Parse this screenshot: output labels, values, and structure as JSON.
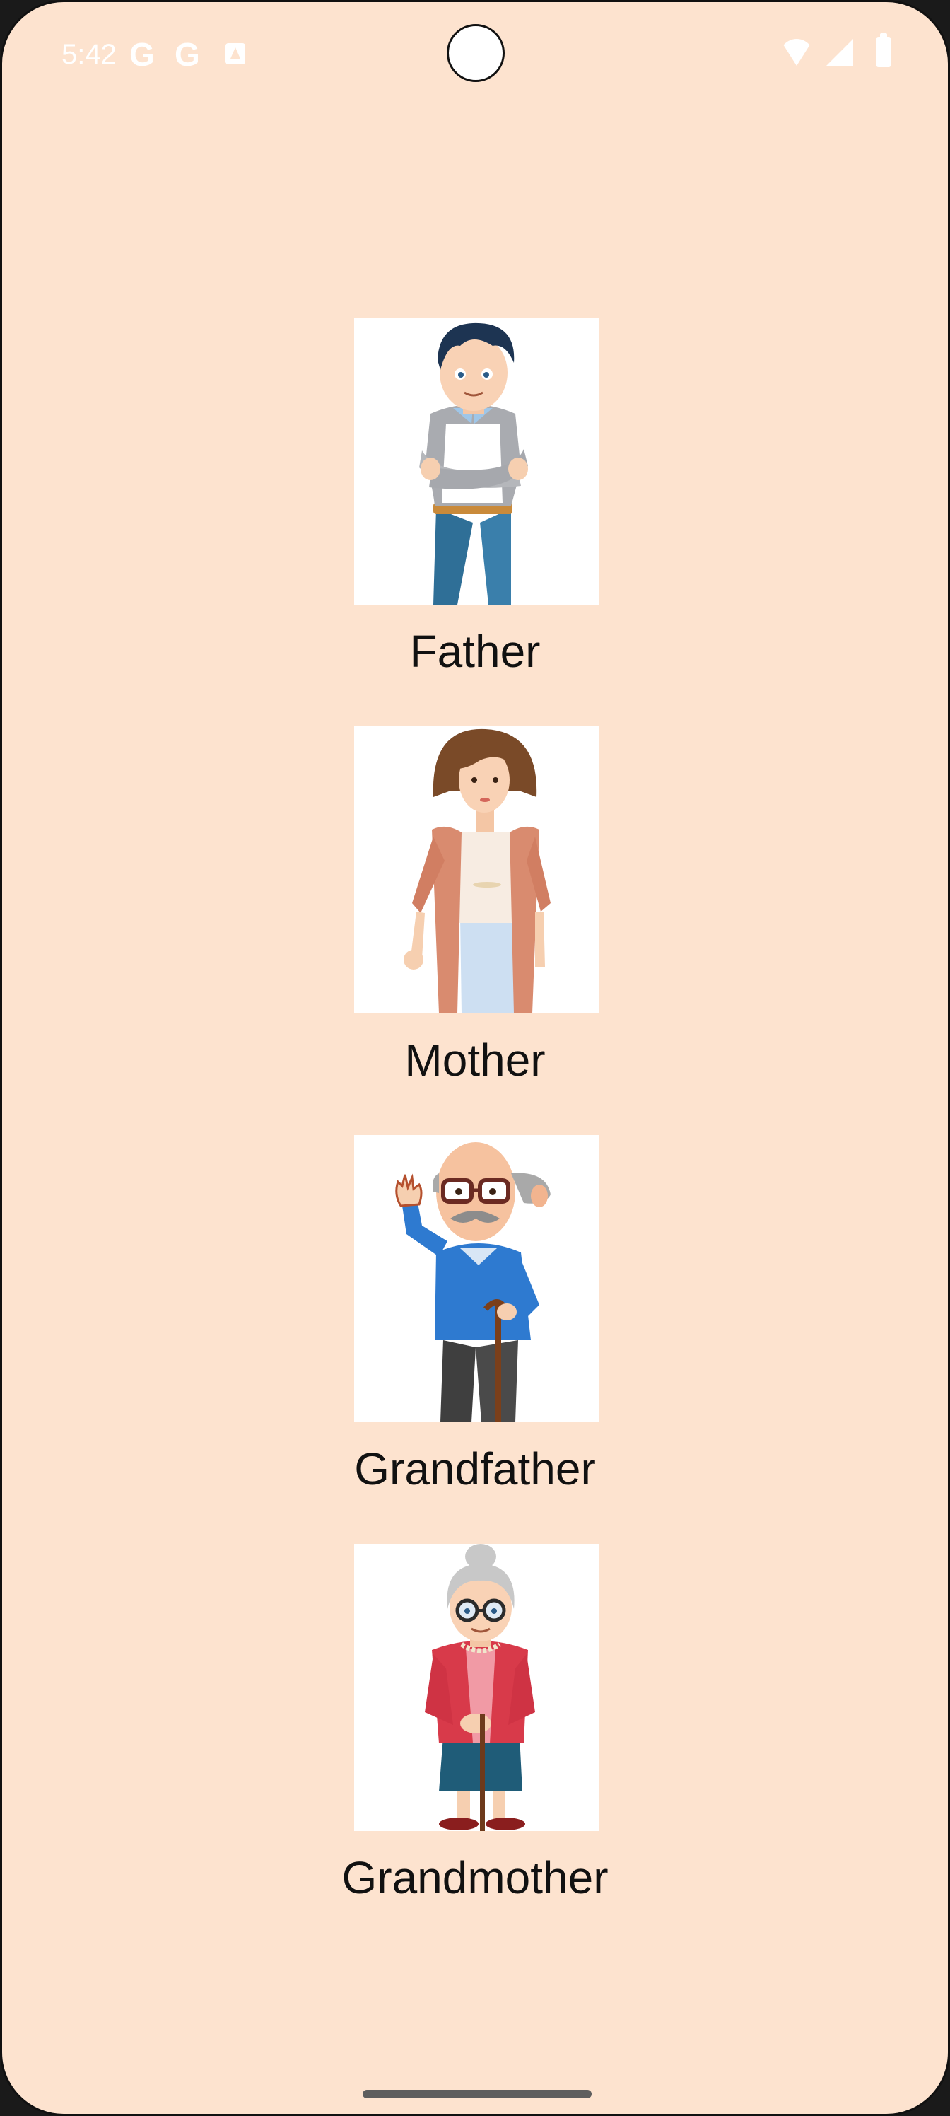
{
  "status_bar": {
    "time": "5:42",
    "notification_icons": [
      "google-icon",
      "google-icon",
      "app-store-icon"
    ],
    "system_icons": [
      "wifi-icon",
      "signal-icon",
      "battery-icon"
    ]
  },
  "family_members": [
    {
      "label": "Father",
      "icon": "father-illustration"
    },
    {
      "label": "Mother",
      "icon": "mother-illustration"
    },
    {
      "label": "Grandfather",
      "icon": "grandfather-illustration"
    },
    {
      "label": "Grandmother",
      "icon": "grandmother-illustration"
    }
  ],
  "colors": {
    "background": "#fde3cf",
    "text": "#111111",
    "card": "#ffffff"
  }
}
